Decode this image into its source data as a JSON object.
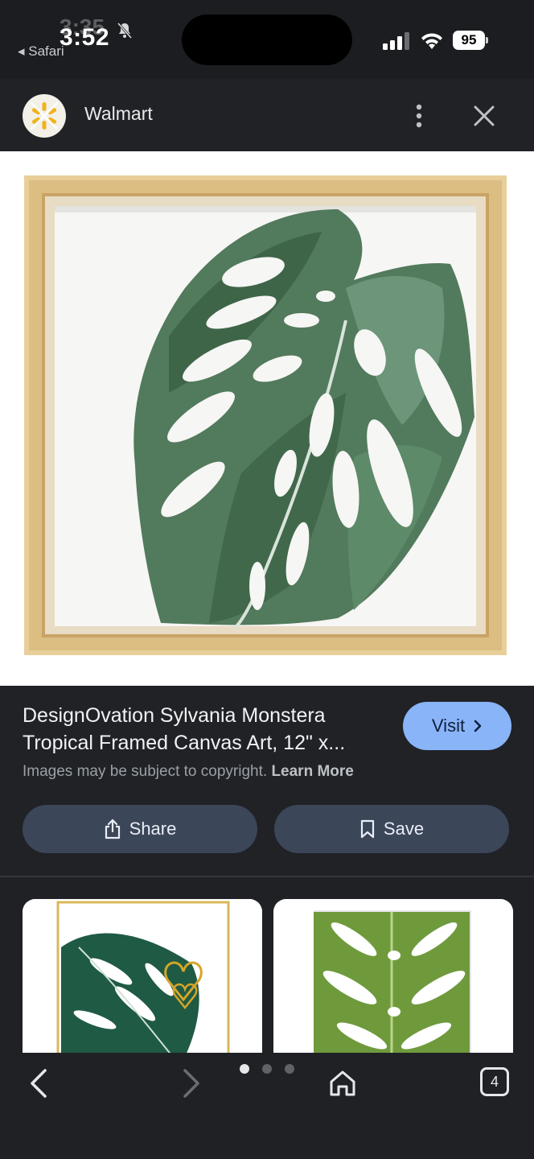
{
  "status_bar": {
    "time": "3:52",
    "time_ghost": "3:35",
    "back_app": "◂ Safari",
    "battery": "95"
  },
  "header": {
    "site_name": "Walmart"
  },
  "product": {
    "title_line1": "DesignOvation Sylvania Monstera",
    "title_line2": "Tropical Framed Canvas Art, 12\" x...",
    "visit_label": "Visit",
    "copyright_text": "Images may be subject to copyright.",
    "learn_more": "Learn More",
    "share_label": "Share",
    "save_label": "Save"
  },
  "bottom_nav": {
    "tab_count": "4"
  },
  "colors": {
    "accent": "#8ab4f8",
    "button_bg": "#3c4659",
    "background": "#202226"
  }
}
